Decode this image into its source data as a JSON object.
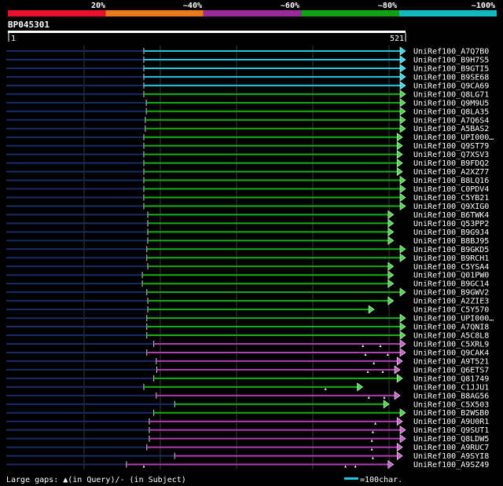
{
  "colors": {
    "background": "#000000",
    "grid": "#3a3a3a",
    "subject_track": "#1a2a66",
    "bins": [
      "#e8102a",
      "#e87a1a",
      "#9a2a9a",
      "#10a010",
      "#10b8c0"
    ],
    "cyan": "#22c8e0",
    "green": "#14b014",
    "purple": "#b43cb4",
    "arrow_cyan": "#30d8ee",
    "arrow_green": "#4cd84c",
    "arrow_purple": "#d25ad2",
    "query_bar": "#ffffff",
    "text": "#ffffff"
  },
  "legend": {
    "labels": [
      "20%",
      "~40%",
      "~60%",
      "~80%",
      "~100%"
    ]
  },
  "query": {
    "name": "BP045301",
    "start_label": "1",
    "end_label": "521",
    "length": 521
  },
  "hits": [
    {
      "name": "UniRef100_A7Q7B0",
      "start": 0,
      "end": 521,
      "color": "cyan",
      "gaps": []
    },
    {
      "name": "UniRef100_B9H7S5",
      "start": 0,
      "end": 521,
      "color": "cyan",
      "gaps": []
    },
    {
      "name": "UniRef100_B9GTI5",
      "start": 0,
      "end": 521,
      "color": "cyan",
      "gaps": []
    },
    {
      "name": "UniRef100_B9SE68",
      "start": 0,
      "end": 521,
      "color": "cyan",
      "gaps": []
    },
    {
      "name": "UniRef100_Q9CA69",
      "start": 0,
      "end": 521,
      "color": "cyan",
      "gaps": []
    },
    {
      "name": "UniRef100_Q8LG71",
      "start": 0,
      "end": 521,
      "color": "green",
      "gaps": []
    },
    {
      "name": "UniRef100_Q9M9U5",
      "start": 5,
      "end": 521,
      "color": "green",
      "gaps": []
    },
    {
      "name": "UniRef100_Q8LA35",
      "start": 5,
      "end": 521,
      "color": "green",
      "gaps": []
    },
    {
      "name": "UniRef100_A7Q6S4",
      "start": 3,
      "end": 521,
      "color": "green",
      "gaps": []
    },
    {
      "name": "UniRef100_A5BAS2",
      "start": 3,
      "end": 521,
      "color": "green",
      "gaps": []
    },
    {
      "name": "UniRef100_UPI000…",
      "start": 0,
      "end": 515,
      "color": "green",
      "gaps": []
    },
    {
      "name": "UniRef100_Q9ST79",
      "start": 0,
      "end": 515,
      "color": "green",
      "gaps": []
    },
    {
      "name": "UniRef100_Q7XSV3",
      "start": 0,
      "end": 515,
      "color": "green",
      "gaps": []
    },
    {
      "name": "UniRef100_B9FDQ2",
      "start": 0,
      "end": 515,
      "color": "green",
      "gaps": []
    },
    {
      "name": "UniRef100_A2XZ77",
      "start": 0,
      "end": 515,
      "color": "green",
      "gaps": []
    },
    {
      "name": "UniRef100_B8LQ16",
      "start": 0,
      "end": 521,
      "color": "green",
      "gaps": []
    },
    {
      "name": "UniRef100_C0PDV4",
      "start": 0,
      "end": 521,
      "color": "green",
      "gaps": []
    },
    {
      "name": "UniRef100_C5YB21",
      "start": 0,
      "end": 521,
      "color": "green",
      "gaps": []
    },
    {
      "name": "UniRef100_Q9XIG0",
      "start": 0,
      "end": 521,
      "color": "green",
      "gaps": []
    },
    {
      "name": "UniRef100_B6TWK4",
      "start": 8,
      "end": 497,
      "color": "green",
      "gaps": []
    },
    {
      "name": "UniRef100_Q53PP2",
      "start": 8,
      "end": 497,
      "color": "green",
      "gaps": []
    },
    {
      "name": "UniRef100_B9G9J4",
      "start": 8,
      "end": 497,
      "color": "green",
      "gaps": []
    },
    {
      "name": "UniRef100_B8BJ95",
      "start": 8,
      "end": 497,
      "color": "green",
      "gaps": []
    },
    {
      "name": "UniRef100_B9GKD5",
      "start": 6,
      "end": 521,
      "color": "green",
      "gaps": []
    },
    {
      "name": "UniRef100_B9RCH1",
      "start": 6,
      "end": 521,
      "color": "green",
      "gaps": []
    },
    {
      "name": "UniRef100_C5YSA4",
      "start": 8,
      "end": 497,
      "color": "green",
      "gaps": []
    },
    {
      "name": "UniRef100_Q01PW0",
      "start": -3,
      "end": 497,
      "color": "green",
      "gaps": []
    },
    {
      "name": "UniRef100_B9GC14",
      "start": -3,
      "end": 497,
      "color": "green",
      "gaps": []
    },
    {
      "name": "UniRef100_B9GWV2",
      "start": 6,
      "end": 521,
      "color": "green",
      "gaps": []
    },
    {
      "name": "UniRef100_A2ZIE3",
      "start": 8,
      "end": 497,
      "color": "green",
      "gaps": []
    },
    {
      "name": "UniRef100_C5Y570",
      "start": 8,
      "end": 458,
      "color": "green",
      "gaps": []
    },
    {
      "name": "UniRef100_UPI000…",
      "start": 6,
      "end": 521,
      "color": "green",
      "gaps": []
    },
    {
      "name": "UniRef100_A7QNI8",
      "start": 6,
      "end": 521,
      "color": "green",
      "gaps": []
    },
    {
      "name": "UniRef100_A5C8L8",
      "start": 6,
      "end": 521,
      "color": "green",
      "gaps": []
    },
    {
      "name": "UniRef100_C5XRL9",
      "start": 20,
      "end": 521,
      "color": "purple",
      "gaps": [
        440,
        475
      ]
    },
    {
      "name": "UniRef100_Q9CAK4",
      "start": 6,
      "end": 521,
      "color": "purple",
      "gaps": [
        445,
        490
      ]
    },
    {
      "name": "UniRef100_A9T521",
      "start": 25,
      "end": 515,
      "color": "purple",
      "gaps": [
        462
      ]
    },
    {
      "name": "UniRef100_Q6ETS7",
      "start": 26,
      "end": 510,
      "color": "purple",
      "gaps": [
        450,
        480
      ]
    },
    {
      "name": "UniRef100_Q81749",
      "start": 20,
      "end": 515,
      "color": "green",
      "gaps": []
    },
    {
      "name": "UniRef100_C1JJU1",
      "start": 0,
      "end": 435,
      "color": "green",
      "gaps": [
        365
      ]
    },
    {
      "name": "UniRef100_B8AG56",
      "start": 25,
      "end": 510,
      "color": "purple",
      "gaps": [
        452,
        483
      ]
    },
    {
      "name": "UniRef100_C5X503",
      "start": 62,
      "end": 488,
      "color": "green",
      "gaps": []
    },
    {
      "name": "UniRef100_B2WSB0",
      "start": 20,
      "end": 521,
      "color": "green",
      "gaps": []
    },
    {
      "name": "UniRef100_A9U0R1",
      "start": 11,
      "end": 515,
      "color": "purple",
      "gaps": [
        465
      ]
    },
    {
      "name": "UniRef100_Q9SUT1",
      "start": 11,
      "end": 521,
      "color": "purple",
      "gaps": [
        460
      ]
    },
    {
      "name": "UniRef100_Q8LDW5",
      "start": 11,
      "end": 521,
      "color": "purple",
      "gaps": [
        458
      ]
    },
    {
      "name": "UniRef100_A9RUC7",
      "start": 6,
      "end": 515,
      "color": "purple",
      "gaps": [
        458
      ]
    },
    {
      "name": "UniRef100_A9SYI8",
      "start": 62,
      "end": 515,
      "color": "purple",
      "gaps": [
        460
      ]
    },
    {
      "name": "UniRef100_A9SZ49",
      "start": -35,
      "end": 497,
      "color": "purple",
      "gaps": [
        0,
        405,
        425
      ]
    }
  ],
  "footer": {
    "gaps_label": "Large gaps: ▲(in Query)/- (in Subject)",
    "scale_label": "=100char."
  }
}
